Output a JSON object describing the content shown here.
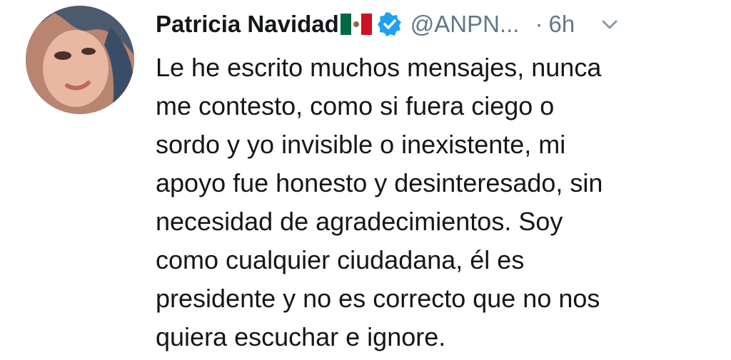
{
  "tweet": {
    "author": {
      "display_name": "Patricia Navidad",
      "flag_icon": "mexico-flag-icon",
      "verified_icon": "verified-badge-icon",
      "handle": "@ANPN...",
      "avatar": "profile-avatar"
    },
    "separator": "·",
    "timestamp": "6h",
    "menu_icon": "chevron-down-icon",
    "text_lines": [
      "Le he escrito muchos mensajes, nunca",
      "me contesto, como si fuera ciego o",
      "sordo y yo invisible o inexistente, mi",
      "apoyo fue honesto y desinteresado, sin",
      "necesidad de agradecimientos. Soy",
      "como cualquier ciudadana, él es",
      "presidente y no es correcto que no nos",
      "quiera escuchar e ignore."
    ]
  },
  "colors": {
    "text_primary": "#14171a",
    "text_secondary": "#657786",
    "verified_blue": "#1da1f2",
    "flag_green": "#006847",
    "flag_red": "#ce1126"
  }
}
